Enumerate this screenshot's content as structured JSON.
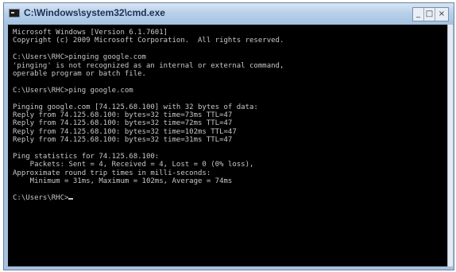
{
  "window": {
    "title": "C:\\Windows\\system32\\cmd.exe",
    "icon": "console-icon"
  },
  "console": {
    "lines": [
      "Microsoft Windows [Version 6.1.7601]",
      "Copyright (c) 2009 Microsoft Corporation.  All rights reserved.",
      "",
      "C:\\Users\\RHC>pinging google.com",
      "'pinging' is not recognized as an internal or external command,",
      "operable program or batch file.",
      "",
      "C:\\Users\\RHC>ping google.com",
      "",
      "Pinging google.com [74.125.68.100] with 32 bytes of data:",
      "Reply from 74.125.68.100: bytes=32 time=73ms TTL=47",
      "Reply from 74.125.68.100: bytes=32 time=72ms TTL=47",
      "Reply from 74.125.68.100: bytes=32 time=102ms TTL=47",
      "Reply from 74.125.68.100: bytes=32 time=31ms TTL=47",
      "",
      "Ping statistics for 74.125.68.100:",
      "    Packets: Sent = 4, Received = 4, Lost = 0 (0% loss),",
      "Approximate round trip times in milli-seconds:",
      "    Minimum = 31ms, Maximum = 102ms, Average = 74ms",
      "",
      "C:\\Users\\RHC>"
    ]
  },
  "colors": {
    "console_bg": "#000000",
    "console_text": "#c8c8c8",
    "titlebar": "#b9d1ea"
  }
}
